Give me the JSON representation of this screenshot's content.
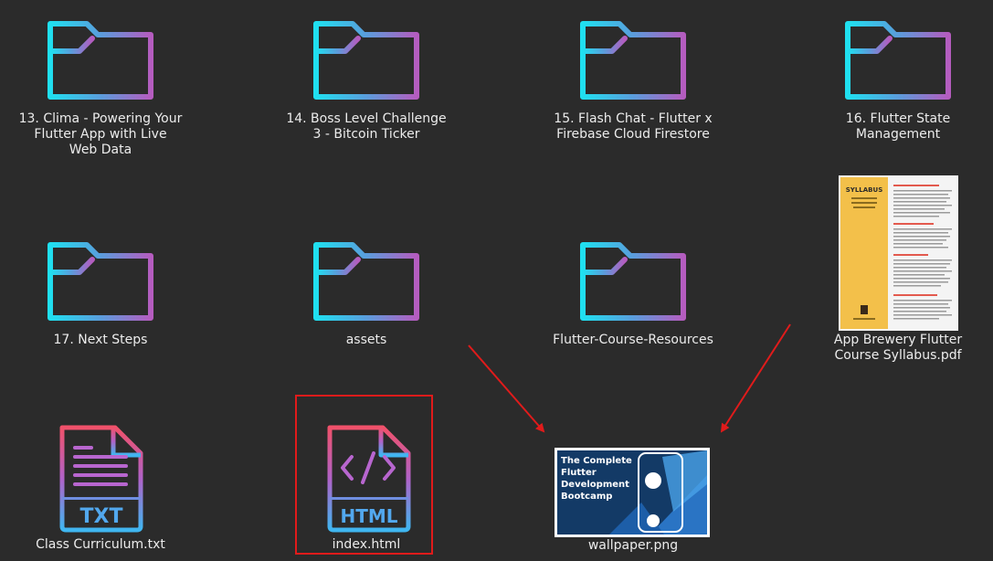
{
  "files": [
    {
      "id": "f13",
      "name": "13. Clima - Powering Your Flutter App with Live Web Data",
      "icon": "folder-icon"
    },
    {
      "id": "f14",
      "name": "14. Boss Level Challenge 3 - Bitcoin Ticker",
      "icon": "folder-icon"
    },
    {
      "id": "f15",
      "name": "15. Flash Chat - Flutter x Firebase Cloud Firestore",
      "icon": "folder-icon"
    },
    {
      "id": "f16",
      "name": "16. Flutter State Management",
      "icon": "folder-icon"
    },
    {
      "id": "f17",
      "name": "17. Next Steps",
      "icon": "folder-icon"
    },
    {
      "id": "assets",
      "name": "assets",
      "icon": "folder-icon"
    },
    {
      "id": "res",
      "name": "Flutter-Course-Resources",
      "icon": "folder-icon"
    },
    {
      "id": "pdf",
      "name": "App Brewery Flutter Course Syllabus.pdf",
      "icon": "pdf-thumbnail"
    },
    {
      "id": "txt",
      "name": "Class Curriculum.txt",
      "icon": "txt-file-icon",
      "badge": "TXT"
    },
    {
      "id": "html",
      "name": "index.html",
      "icon": "html-file-icon",
      "badge": "HTML",
      "selected": true
    },
    {
      "id": "png",
      "name": "wallpaper.png",
      "icon": "image-thumbnail"
    }
  ],
  "thumbnails": {
    "pdf": {
      "heading": "SYLLABUS"
    },
    "png": {
      "lines": [
        "The Complete",
        "Flutter",
        "Development",
        "Bootcamp"
      ]
    }
  },
  "colors": {
    "background": "#2b2b2b",
    "folder_gradient_start": "#1fe0f0",
    "folder_gradient_end": "#b55cbf",
    "file_gradient_top": "#f0516a",
    "file_gradient_bottom": "#3fb6f0",
    "annotation_red": "#e01b1b"
  }
}
